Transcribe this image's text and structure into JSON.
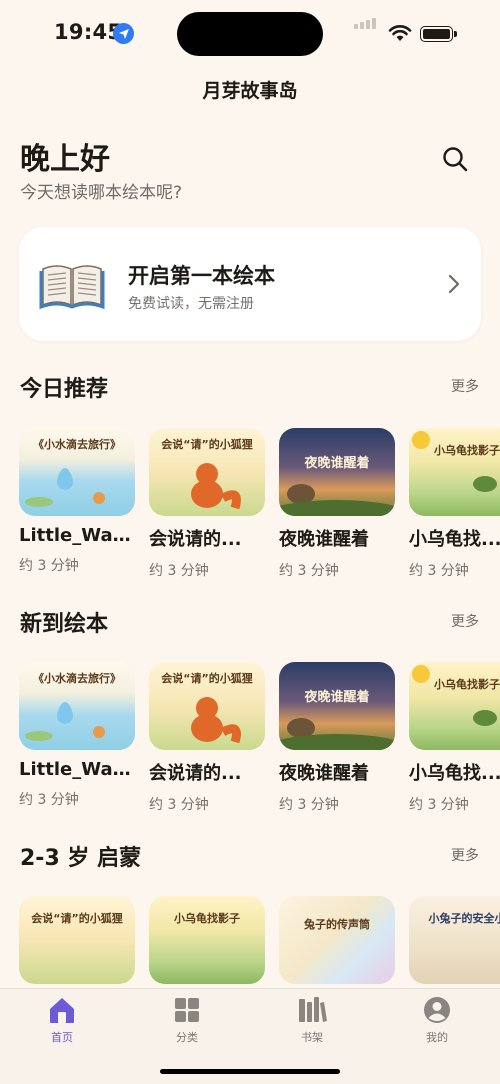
{
  "status_bar": {
    "time": "19:45"
  },
  "app_title": "月芽故事岛",
  "header": {
    "greeting": "晚上好",
    "subtitle": "今天想读哪本绘本呢?"
  },
  "hero": {
    "title": "开启第一本绘本",
    "subtitle": "免费试读，无需注册"
  },
  "sections": [
    {
      "title": "今日推荐",
      "more": "更多",
      "items": [
        {
          "title": "Little_Wat...",
          "meta": "约 3 分钟",
          "cover_text": "《小水滴去旅行》"
        },
        {
          "title": "会说请的...",
          "meta": "约 3 分钟",
          "cover_text": "会说“请”的小狐狸"
        },
        {
          "title": "夜晚谁醒着",
          "meta": "约 3 分钟",
          "cover_text": "夜晚谁醒着"
        },
        {
          "title": "小乌龟找...",
          "meta": "约 3 分钟",
          "cover_text": "小乌龟找影子"
        }
      ]
    },
    {
      "title": "新到绘本",
      "more": "更多",
      "items": [
        {
          "title": "Little_Wat...",
          "meta": "约 3 分钟",
          "cover_text": "《小水滴去旅行》"
        },
        {
          "title": "会说请的...",
          "meta": "约 3 分钟",
          "cover_text": "会说“请”的小狐狸"
        },
        {
          "title": "夜晚谁醒着",
          "meta": "约 3 分钟",
          "cover_text": "夜晚谁醒着"
        },
        {
          "title": "小乌龟找...",
          "meta": "约 3 分钟",
          "cover_text": "小乌龟找影子"
        }
      ]
    },
    {
      "title": "2-3 岁 启蒙",
      "more": "更多",
      "items": [
        {
          "cover_text": "会说“请”的小狐狸"
        },
        {
          "cover_text": "小乌龟找影子"
        },
        {
          "cover_text": "兔子的传声筒"
        },
        {
          "cover_text": "小兔子的安全小"
        }
      ]
    }
  ],
  "tabs": [
    {
      "label": "首页",
      "icon": "home-icon",
      "active": true
    },
    {
      "label": "分类",
      "icon": "grid-icon",
      "active": false
    },
    {
      "label": "书架",
      "icon": "bookshelf-icon",
      "active": false
    },
    {
      "label": "我的",
      "icon": "profile-icon",
      "active": false
    }
  ],
  "colors": {
    "background": "#FDF6EE",
    "accent": "#6B5BD6",
    "location_blue": "#2F7BF6"
  }
}
